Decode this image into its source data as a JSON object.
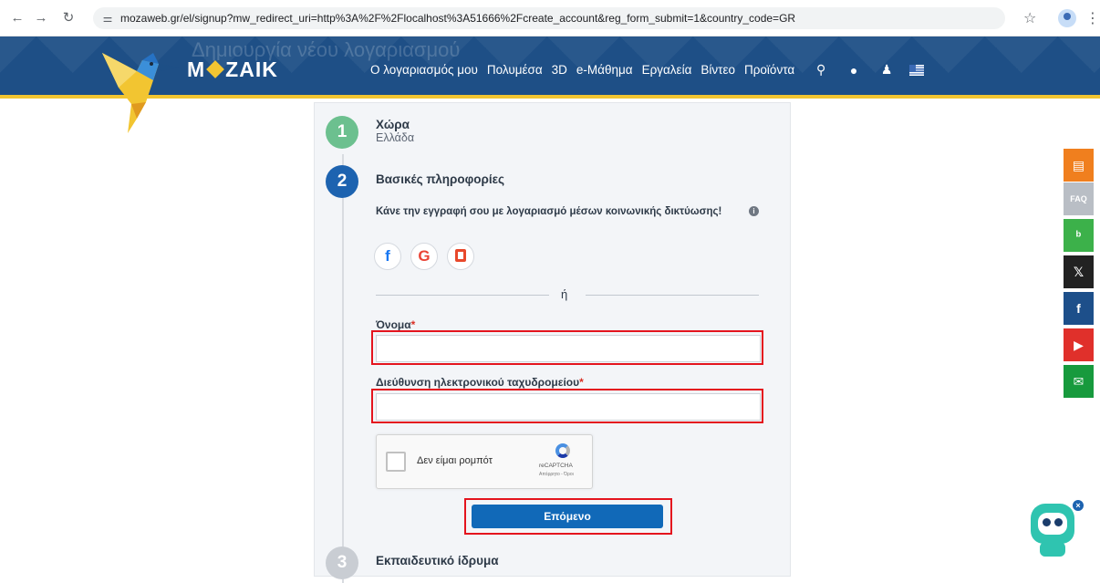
{
  "browser": {
    "url": "mozaweb.gr/el/signup?mw_redirect_uri=http%3A%2F%2Flocalhost%3A51666%2Fcreate_account&reg_form_submit=1&country_code=GR"
  },
  "header": {
    "ghost_title": "Δημιουργία νέου λογαριασμού",
    "brand_left": "M",
    "brand_right": "ZAIK",
    "nav": [
      "Ο λογαριασμός μου",
      "Πολυμέσα",
      "3D",
      "e-Μάθημα",
      "Εργαλεία",
      "Βίντεο",
      "Προϊόντα"
    ]
  },
  "steps": {
    "step1": {
      "number": "1",
      "title": "Χώρα",
      "value": "Ελλάδα"
    },
    "step2": {
      "number": "2",
      "title": "Βασικές πληροφορίες"
    },
    "step3": {
      "number": "3",
      "title": "Εκπαιδευτικό ίδρυμα"
    }
  },
  "social": {
    "text": "Κάνε την εγγραφή σου με λογαριασμό μέσων κοινωνικής δικτύωσης!",
    "facebook_glyph": "f",
    "google_glyph": "G"
  },
  "divider_text": "ή",
  "form": {
    "name_label": "Όνομα",
    "email_label": "Διεύθυνση ηλεκτρονικού ταχυδρομείου",
    "required_mark": "*",
    "name_value": "",
    "email_value": ""
  },
  "captcha": {
    "label": "Δεν είμαι ρομπότ",
    "brand": "reCAPTCHA",
    "terms": "Απόρρητο - Όροι"
  },
  "next_button": "Επόμενο",
  "side_social": [
    {
      "name": "news",
      "glyph": "▤",
      "color": "#f07f1e"
    },
    {
      "name": "faq",
      "glyph": "FAQ",
      "color": "#b9bec5"
    },
    {
      "name": "blog",
      "glyph": "ᵇ",
      "color": "#3cb14a"
    },
    {
      "name": "x",
      "glyph": "𝕏",
      "color": "#222222"
    },
    {
      "name": "facebook",
      "glyph": "f",
      "color": "#1d4f8a"
    },
    {
      "name": "youtube",
      "glyph": "▶",
      "color": "#e0302b"
    },
    {
      "name": "email",
      "glyph": "✉",
      "color": "#179a3d"
    }
  ]
}
